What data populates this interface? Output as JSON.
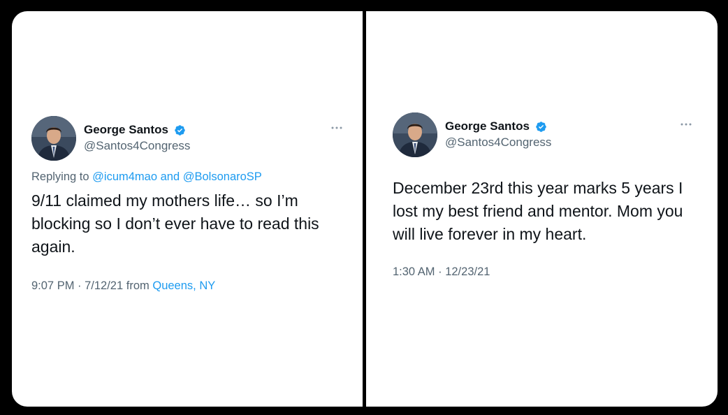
{
  "tweets": [
    {
      "display_name": "George Santos",
      "handle": "@Santos4Congress",
      "reply_prefix": "Replying to",
      "reply_user1": "@icum4mao",
      "reply_and": "and",
      "reply_user2": "@BolsonaroSP",
      "text": "9/11 claimed my mothers life… so I’m blocking so I don’t ever have to read this again.",
      "timestamp": "9:07 PM · 7/12/21",
      "from_label": "from",
      "location": "Queens, NY"
    },
    {
      "display_name": "George Santos",
      "handle": "@Santos4Congress",
      "text": "December 23rd this year marks 5 years I lost my best friend and mentor. Mom you will live forever in my heart.",
      "timestamp": "1:30 AM · 12/23/21"
    }
  ],
  "colors": {
    "link": "#1d9bf0",
    "secondary_text": "#536471",
    "primary_text": "#0f1419",
    "verified_badge": "#1d9bf0"
  },
  "icons": {
    "verified": "verified-badge-icon",
    "more": "more-options-icon"
  }
}
